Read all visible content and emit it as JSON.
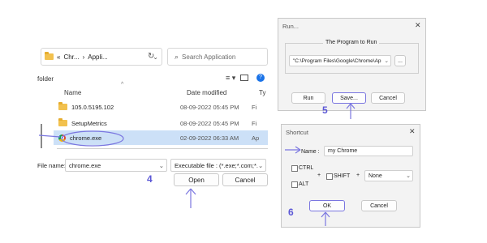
{
  "file_dialog": {
    "breadcrumb": [
      "«",
      "Chr...",
      "›",
      "Appli..."
    ],
    "search_placeholder": "Search Application",
    "sidebar_label": "folder",
    "columns": {
      "name": "Name",
      "date": "Date modified",
      "type": "Ty"
    },
    "rows": [
      {
        "name": "105.0.5195.102",
        "date": "08-09-2022 05:45 PM",
        "type": "Fi",
        "icon": "folder-icon"
      },
      {
        "name": "SetupMetrics",
        "date": "08-09-2022 05:45 PM",
        "type": "Fi",
        "icon": "folder-icon"
      },
      {
        "name": "chrome.exe",
        "date": "02-09-2022 06:33 AM",
        "type": "Ap",
        "icon": "chrome-icon",
        "selected": true
      }
    ],
    "filename_label": "File name:",
    "filename_value": "chrome.exe",
    "filetype_value": "Executable file : (*.exe;*.com;*.",
    "open_label": "Open",
    "cancel_label": "Cancel",
    "step": "4"
  },
  "run_dialog": {
    "title": "Run...",
    "close": "✕",
    "group_title": "The Program to Run",
    "program_path": "\"C:\\Program Files\\Google\\Chrome\\Ap",
    "browse_label": "...",
    "run_label": "Run",
    "save_label": "Save...",
    "cancel_label": "Cancel",
    "step": "5"
  },
  "shortcut_dialog": {
    "title": "Shortcut",
    "close": "✕",
    "name_label": "Name :",
    "name_value": "my Chrome",
    "ctrl_label": "CTRL",
    "alt_label": "ALT",
    "shift_label": "SHIFT",
    "plus1": "+",
    "plus2": "+",
    "key_value": "None",
    "ok_label": "OK",
    "cancel_label": "Cancel",
    "step": "6"
  },
  "colors": {
    "accent_annotation": "#5b57d6",
    "selection": "#cce0f7"
  }
}
